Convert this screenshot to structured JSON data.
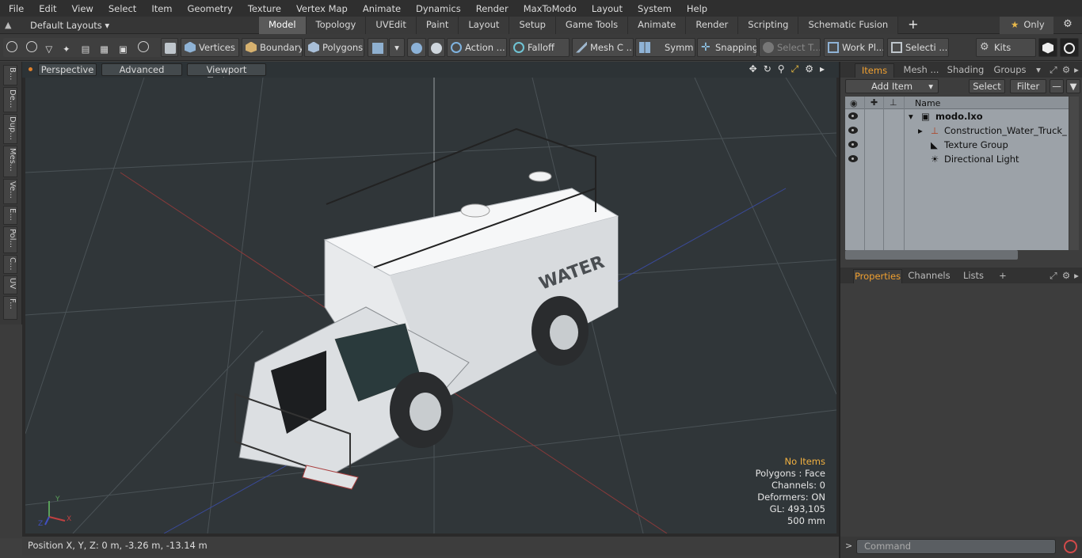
{
  "menu": [
    "File",
    "Edit",
    "View",
    "Select",
    "Item",
    "Geometry",
    "Texture",
    "Vertex Map",
    "Animate",
    "Dynamics",
    "Render",
    "MaxToModo",
    "Layout",
    "System",
    "Help"
  ],
  "layout": {
    "default_layouts": "Default Layouts ▾",
    "tabs": [
      "Model",
      "Topology",
      "UVEdit",
      "Paint",
      "Layout",
      "Setup",
      "Game Tools",
      "Animate",
      "Render",
      "Scripting",
      "Schematic Fusion"
    ],
    "active_tab": "Model",
    "only_label": "Only"
  },
  "toolbar": {
    "vertices": "Vertices",
    "boundary": "Boundary",
    "polygons": "Polygons",
    "action": "Action",
    "falloff": "Falloff",
    "mesh_c": "Mesh C ...",
    "symm": "Symm ...",
    "snapping": "Snapping",
    "select_t": "Select T...",
    "work_pl": "Work Pl...",
    "selecti": "Selecti ...",
    "kits": "Kits"
  },
  "left_tabs": [
    "B...",
    "De...",
    "Dup...",
    "Mes...",
    "Ve...",
    "E...",
    "Pol...",
    "C...",
    "UV",
    "F..."
  ],
  "viewport": {
    "perspective": "Perspective",
    "advanced": "Advanced",
    "viewport_textures": "Viewport Textures",
    "truck_text": "WATER",
    "stats": {
      "items": "No Items",
      "polygons": "Polygons : Face",
      "channels": "Channels: 0",
      "deformers": "Deformers: ON",
      "gl": "GL: 493,105",
      "scale": "500 mm"
    },
    "axes": {
      "y": "Y",
      "x": "X",
      "z": "Z"
    }
  },
  "status": {
    "position": "Position X, Y, Z:   0 m, -3.26 m, -13.14 m"
  },
  "right_panel": {
    "tabs": [
      "Items",
      "Mesh ...",
      "Shading",
      "Groups"
    ],
    "active_tab": "Items",
    "add_item": "Add Item",
    "select": "Select",
    "filter": "Filter",
    "column_name": "Name",
    "items": [
      {
        "name": "modo.lxo"
      },
      {
        "name": "Construction_Water_Truck_ ..."
      },
      {
        "name": "Texture Group"
      },
      {
        "name": "Directional Light"
      }
    ],
    "prop_tabs": [
      "Properties",
      "Channels",
      "Lists"
    ],
    "command_placeholder": "Command"
  },
  "colors": {
    "accent": "#f0a030",
    "viewport_bg": "#303639"
  }
}
